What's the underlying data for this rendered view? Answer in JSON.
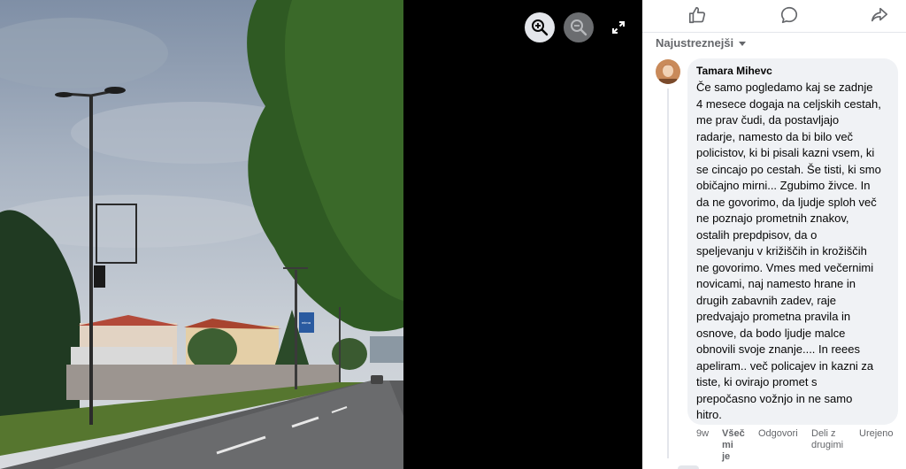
{
  "viewer": {
    "zoom_in_icon": "zoom-in-icon",
    "zoom_out_icon": "zoom-out-icon",
    "fullscreen_icon": "fullscreen-icon",
    "photo_sign": "mirna"
  },
  "actions": {
    "like_icon": "thumbs-up-icon",
    "comment_icon": "comment-bubble-icon",
    "share_icon": "share-arrow-icon"
  },
  "sort": {
    "label": "Najustreznejši"
  },
  "comment": {
    "author": "Tamara Mihevc",
    "lines": [
      "Če samo pogledamo kaj se zadnje",
      "4 mesece dogaja na celjskih cestah,",
      "me prav čudi, da postavljajo",
      "radarje, namesto da bi bilo več",
      "policistov, ki bi pisali kazni vsem, ki",
      "se cincajo po cestah. Še tisti, ki smo",
      "običajno mirni... Zgubimo živce. In",
      "da ne govorimo, da ljudje sploh več",
      "ne poznajo prometnih znakov,",
      "ostalih prepdpisov, da o",
      "speljevanju v križiščih in krožiščih",
      "ne govorimo. Vmes med večernimi",
      "novicami, naj namesto hrane in",
      "drugih zabavnih zadev, raje",
      "predvajajo prometna pravila in",
      "osnove, da bodo ljudje malce",
      "obnovili svoje znanje.... In reees",
      "apeliram.. več policajev in kazni za",
      "tiste, ki ovirajo promet s",
      "prepočasno vožnjo in ne samo",
      "hitro."
    ],
    "time": "9w",
    "like_label": [
      "Všeč",
      "mi",
      "je"
    ],
    "reply_label": "Odgovori",
    "share_label": [
      "Deli z",
      "drugimi"
    ],
    "edit_label": "Urejeno"
  },
  "colors": {
    "panel_bg": "#ffffff",
    "bubble_bg": "#f0f2f5",
    "meta_text": "#65676b",
    "viewer_bg": "#000000"
  }
}
